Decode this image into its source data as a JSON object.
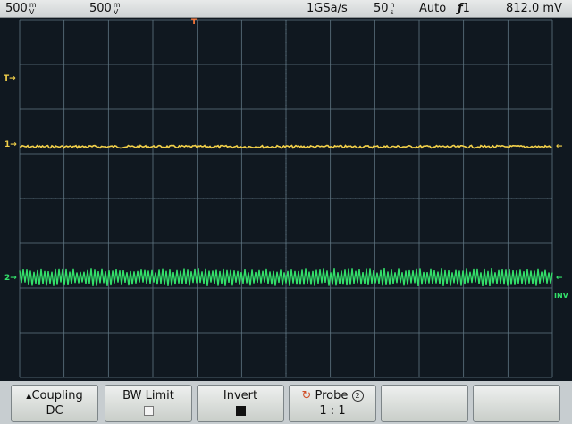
{
  "status": {
    "ch1_scale": "500",
    "ch1_unit_top": "m",
    "ch1_unit_bottom": "V",
    "ch2_scale": "500",
    "ch2_unit_top": "m",
    "ch2_unit_bottom": "V",
    "sample_rate": "1GSa/s",
    "timebase": "50",
    "time_unit_top": "n",
    "time_unit_bottom": "s",
    "trigger_mode": "Auto",
    "trigger_source": "1",
    "trigger_level": "812.0 mV"
  },
  "markers": {
    "trigger_pos": "T",
    "ch1": "1",
    "ch2": "2",
    "trigger_level_mark": "T",
    "ch2_invert": "INV"
  },
  "softkeys": {
    "coupling_label": "Coupling",
    "coupling_value": "DC",
    "bw_label": "BW Limit",
    "invert_label": "Invert",
    "probe_label": "Probe",
    "probe_circle": "2",
    "probe_value": "1 : 1"
  },
  "colors": {
    "ch1": "#f2d04a",
    "ch2": "#33e06a",
    "grid": "#5f7683",
    "trigger": "#ff7a3a"
  }
}
